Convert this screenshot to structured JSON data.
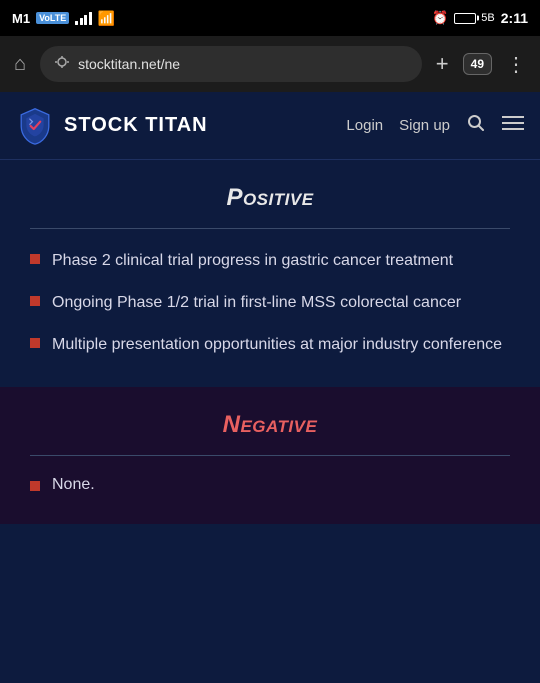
{
  "statusBar": {
    "carrier": "M1",
    "carrierBadge": "VoLTE",
    "time": "2:11",
    "tabCount": "49",
    "alarmIcon": "⏰"
  },
  "addressBar": {
    "url": "stocktitan.net/ne",
    "tabCount": "49",
    "homeIcon": "⌂",
    "addIcon": "+",
    "menuIcon": "⋮"
  },
  "header": {
    "logoText": "STOCK TITAN",
    "loginLabel": "Login",
    "signupLabel": "Sign up"
  },
  "positiveSection": {
    "title": "Positive",
    "bullets": [
      "Phase 2 clinical trial progress in gastric cancer treatment",
      "Ongoing Phase 1/2 trial in first-line MSS colorectal cancer",
      "Multiple presentation opportunities at major industry conference"
    ]
  },
  "negativeSection": {
    "title": "Negative",
    "bullets": [
      "None."
    ]
  }
}
